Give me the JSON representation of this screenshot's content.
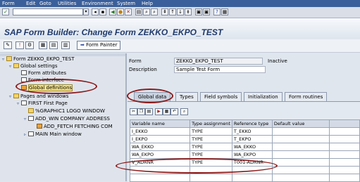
{
  "menu": [
    "Form",
    "Edit",
    "Goto",
    "Utilities",
    "Environment",
    "System",
    "Help"
  ],
  "title": "SAP Form Builder: Change Form ZEKKO_EKPO_TEST",
  "app_toolbar": {
    "form_painter_label": "Form Painter"
  },
  "tree": {
    "nodes": [
      {
        "label": "Form ZEKKO_EKPO_TEST"
      },
      {
        "label": "Global settings"
      },
      {
        "label": "Form attributes"
      },
      {
        "label": "Form interface"
      },
      {
        "label": "Global definitions"
      },
      {
        "label": "Pages and windows"
      },
      {
        "label": "FIRST First Page"
      },
      {
        "label": "%GRAPHIC1 LOGO WINDOW"
      },
      {
        "label": "ADD_WIN COMPANY ADDRESS"
      },
      {
        "label": "ADD_FETCH FETCHING COM"
      },
      {
        "label": "MAIN Main window"
      }
    ]
  },
  "header": {
    "form_label": "Form",
    "form_value": "ZEKKO_EKPO_TEST",
    "status": "Inactive",
    "desc_label": "Description",
    "desc_value": "Sample Test Form"
  },
  "tabs": [
    "Global data",
    "Types",
    "Field symbols",
    "Initialization",
    "Form routines"
  ],
  "grid": {
    "columns": [
      "Variable name",
      "Type assignment",
      "Reference type",
      "Default value"
    ],
    "rows": [
      [
        "I_EKKO",
        "TYPE",
        "T_EKKO",
        ""
      ],
      [
        "I_EKPO",
        "TYPE",
        "T_EKPO",
        ""
      ],
      [
        "WA_EKKO",
        "TYPE",
        "WA_EKKO",
        ""
      ],
      [
        "WA_EKPO",
        "TYPE",
        "WA_EKPO",
        ""
      ],
      [
        "V_ADRNR",
        "TYPE",
        "T001-ADRNR",
        ""
      ],
      [
        "",
        "",
        "",
        ""
      ],
      [
        "",
        "",
        "",
        ""
      ]
    ]
  },
  "colors": {
    "menubar": "#3b5f9a",
    "title": "#203a6c",
    "annotation": "#8b1a1a",
    "selected": "#f3e28a"
  }
}
